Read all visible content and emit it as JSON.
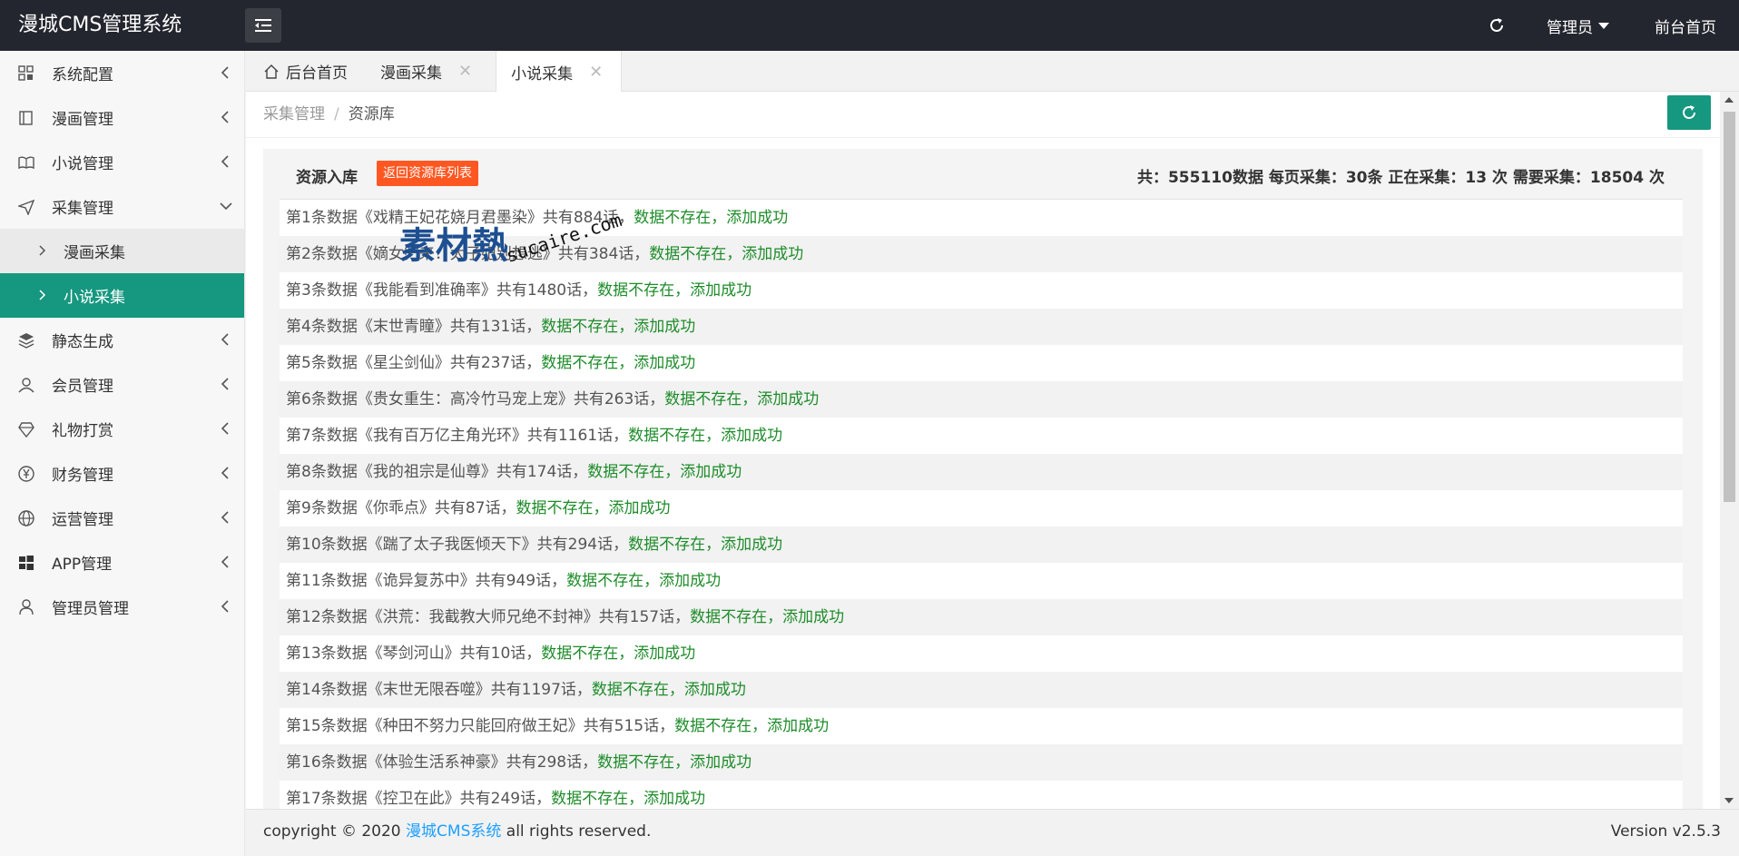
{
  "header": {
    "title": "漫城CMS管理系统",
    "admin_label": "管理员",
    "front_label": "前台首页"
  },
  "sidebar": {
    "items": [
      {
        "label": "系统配置",
        "icon": "grid-icon"
      },
      {
        "label": "漫画管理",
        "icon": "book-icon"
      },
      {
        "label": "小说管理",
        "icon": "open-book-icon"
      },
      {
        "label": "采集管理",
        "icon": "send-icon",
        "expanded": true
      },
      {
        "label": "静态生成",
        "icon": "layers-icon"
      },
      {
        "label": "会员管理",
        "icon": "user-icon"
      },
      {
        "label": "礼物打赏",
        "icon": "diamond-icon"
      },
      {
        "label": "财务管理",
        "icon": "yen-icon"
      },
      {
        "label": "运营管理",
        "icon": "globe-icon"
      },
      {
        "label": "APP管理",
        "icon": "windows-icon"
      },
      {
        "label": "管理员管理",
        "icon": "person-icon"
      }
    ],
    "sub_items": [
      {
        "label": "漫画采集",
        "active": false
      },
      {
        "label": "小说采集",
        "active": true
      }
    ]
  },
  "tabs": [
    {
      "label": "后台首页",
      "closable": false,
      "active": false
    },
    {
      "label": "漫画采集",
      "closable": true,
      "active": false
    },
    {
      "label": "小说采集",
      "closable": true,
      "active": true
    }
  ],
  "breadcrumb": {
    "parent": "采集管理",
    "separator": "/",
    "current": "资源库"
  },
  "panel": {
    "title": "资源入库",
    "back_button": "返回资源库列表",
    "stats": "共：555110数据 每页采集：30条 正在采集：13 次 需要采集：18504 次"
  },
  "rows": [
    {
      "prefix": "第1条数据《戏精王妃花娆月君墨染》共有884话，",
      "status": "数据不存在，添加成功"
    },
    {
      "prefix": "第2条数据《嫡女归来：太子妃别想逃》共有384话，",
      "status": "数据不存在，添加成功"
    },
    {
      "prefix": "第3条数据《我能看到准确率》共有1480话，",
      "status": "数据不存在，添加成功"
    },
    {
      "prefix": "第4条数据《末世青瞳》共有131话，",
      "status": "数据不存在，添加成功"
    },
    {
      "prefix": "第5条数据《星尘剑仙》共有237话，",
      "status": "数据不存在，添加成功"
    },
    {
      "prefix": "第6条数据《贵女重生：高冷竹马宠上宠》共有263话，",
      "status": "数据不存在，添加成功"
    },
    {
      "prefix": "第7条数据《我有百万亿主角光环》共有1161话，",
      "status": "数据不存在，添加成功"
    },
    {
      "prefix": "第8条数据《我的祖宗是仙尊》共有174话，",
      "status": "数据不存在，添加成功"
    },
    {
      "prefix": "第9条数据《你乖点》共有87话，",
      "status": "数据不存在，添加成功"
    },
    {
      "prefix": "第10条数据《踹了太子我医倾天下》共有294话，",
      "status": "数据不存在，添加成功"
    },
    {
      "prefix": "第11条数据《诡异复苏中》共有949话，",
      "status": "数据不存在，添加成功"
    },
    {
      "prefix": "第12条数据《洪荒：我截教大师兄绝不封神》共有157话，",
      "status": "数据不存在，添加成功"
    },
    {
      "prefix": "第13条数据《琴剑河山》共有10话，",
      "status": "数据不存在，添加成功"
    },
    {
      "prefix": "第14条数据《末世无限吞噬》共有1197话，",
      "status": "数据不存在，添加成功"
    },
    {
      "prefix": "第15条数据《种田不努力只能回府做王妃》共有515话，",
      "status": "数据不存在，添加成功"
    },
    {
      "prefix": "第16条数据《体验生活系神豪》共有298话，",
      "status": "数据不存在，添加成功"
    },
    {
      "prefix": "第17条数据《控卫在此》共有249话，",
      "status": "数据不存在，添加成功"
    }
  ],
  "footer": {
    "copyright_prefix": "copyright © 2020 ",
    "brand": "漫城CMS系统",
    "copyright_suffix": " all rights reserved.",
    "version": "Version v2.5.3"
  },
  "watermark": {
    "mark": "素材熱",
    "text": "sucaire.com"
  },
  "colors": {
    "topbar": "#23262e",
    "accent": "#16977f",
    "success": "#1e8c2a",
    "danger": "#ff5722",
    "link": "#1e9fff"
  }
}
